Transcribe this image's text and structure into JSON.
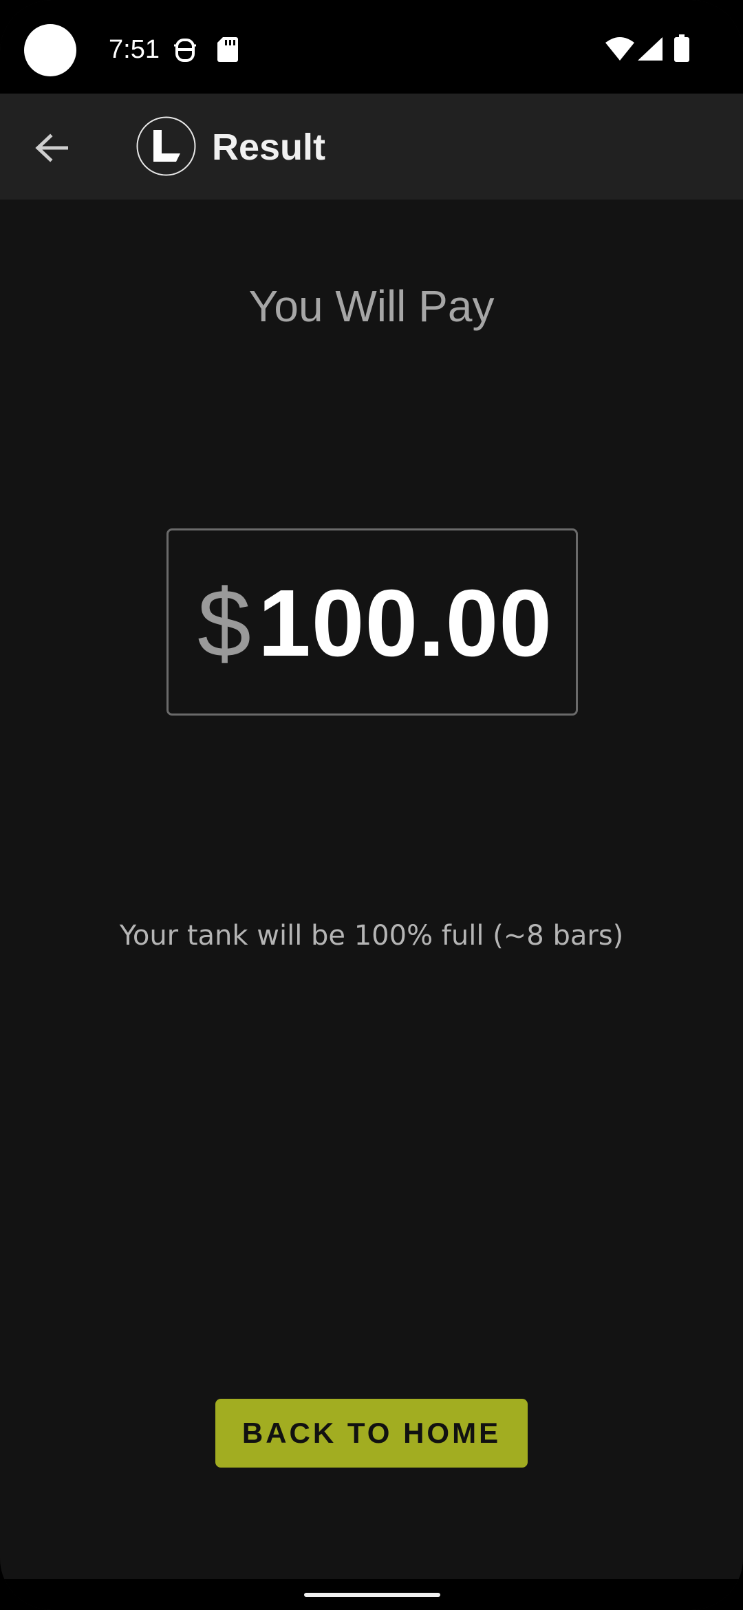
{
  "status_bar": {
    "time": "7:51",
    "icons": [
      "camera-cutout",
      "debug-icon",
      "sd-card-icon",
      "wifi-icon",
      "cell-signal-icon",
      "battery-icon"
    ]
  },
  "app_bar": {
    "back_icon": "arrow-left-icon",
    "logo_icon": "app-logo-icon",
    "title": "Result"
  },
  "result": {
    "heading": "You Will Pay",
    "currency_symbol": "$",
    "amount": "100.00",
    "tank_info": "Your tank will be 100% full (~8 bars)"
  },
  "actions": {
    "home_button_label": "BACK TO HOME",
    "home_button_color": "#a2ad21"
  },
  "colors": {
    "background": "#131313",
    "app_bar": "#212121",
    "status_bar": "#000000"
  }
}
